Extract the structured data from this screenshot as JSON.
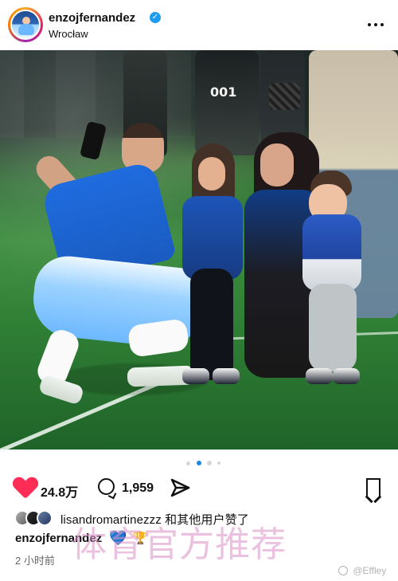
{
  "post": {
    "username": "enzojfernandez",
    "location": "Wrocław",
    "verified_badge_text": "✓",
    "more_icon": "more-horizontal-icon",
    "photo": {
      "vest_number": "001"
    },
    "carousel": {
      "count": 4,
      "active_index": 1,
      "active_color": "#1e88e5",
      "inactive_color": "#d6d6d6"
    },
    "actions": {
      "likes": "24.8万",
      "comments": "1,959",
      "like_icon": "heart-icon",
      "comment_icon": "comment-icon",
      "share_icon": "share-icon",
      "save_icon": "bookmark-icon",
      "like_color": "#ff2d55"
    },
    "liked_by": {
      "text": "lisandromartinezzz 和其他用户赞了"
    },
    "caption": {
      "username": "enzojfernandez",
      "heart": "💙",
      "trophy": "🏆"
    },
    "timestamp": "2 小时前",
    "overlay_text": "体育官方推荐",
    "watermark": "@Effley"
  }
}
